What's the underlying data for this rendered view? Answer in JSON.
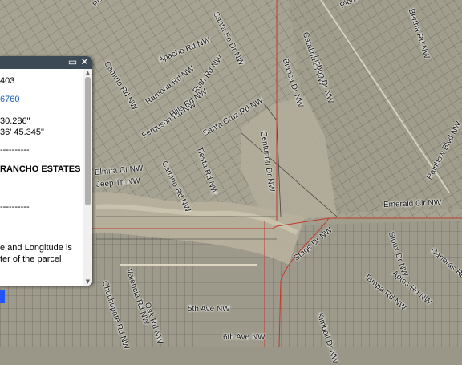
{
  "map": {
    "road_labels": [
      "Pecos Rd NW",
      "Santa Fe Dr NW",
      "Apache Rd NW",
      "Catalina Dr NW",
      "Pleasant",
      "Camino Rd NW",
      "Ramona Rd NW",
      "Bertha Rd NW",
      "Ruth Rd NW",
      "Ferguson Rd NW",
      "Hills Rd NW",
      "Tiesta Rd NW",
      "Santa Cruz Rd NW",
      "Elmira Ct NW",
      "Jeep Trl NW",
      "Camino Rd NW",
      "Bianca Dr NW",
      "Lisbon Dr NW",
      "Centurion Dr NW",
      "Emerald Cir NW",
      "Rainbow Blvd NW",
      "Sioux Dr NW",
      "Stage Dr NW",
      "Tampa Rd NW",
      "Aptos Rd NW",
      "Caneras Rd NW",
      "Chuchupate Rd NW",
      "Valencia Rd NW",
      "Oak Rd NW",
      "Kimball Dr NW",
      "5th Ave NW",
      "6th Ave NW"
    ]
  },
  "popup": {
    "lines": [
      "403",
      "6760",
      "30.286\"",
      "36' 45.345\"",
      "----------",
      "RANCHO ESTATES",
      "----------",
      "e and Longitude is",
      "ter of the parcel"
    ],
    "link_color": "#1a5fb4"
  }
}
